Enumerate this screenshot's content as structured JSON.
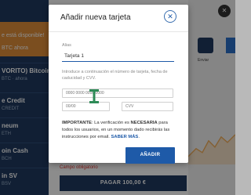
{
  "background": {
    "promo_line1": "e está disponible!",
    "promo_line2": "BTC ahora",
    "list": [
      {
        "title": "VORITO) Bitcoin",
        "sub": "BTC · ahora"
      },
      {
        "title": "e Credit",
        "sub": "CREDIT"
      },
      {
        "title": "neum",
        "sub": "ETH"
      },
      {
        "title": "oin Cash",
        "sub": "BCH"
      },
      {
        "title": "in SV",
        "sub": "BSV"
      }
    ],
    "right_label": "Enviar",
    "right_close": "✕",
    "error_text": "Campo obligatorio",
    "pay_button": "PAGAR  100,00 €"
  },
  "modal": {
    "title": "Añadir nueva tarjeta",
    "close_icon": "close-icon",
    "alias_label": "Alias",
    "alias_value": "Tarjeta 1",
    "instruction": "Introduce a continuación el número de tarjeta, fecha de caducidad y CVV.",
    "card_number_placeholder": "0000 0000 0000 0000",
    "expiry_placeholder": "00/00",
    "cvv_placeholder": "CVV",
    "notice_strong1": "IMPORTANTE",
    "notice_part1": ": La verificación es ",
    "notice_strong2": "NECESARIA",
    "notice_part2": " para todos los usuarios, en un momento dado recibirás las instrucciones por email. ",
    "saber_mas": "SABER MÁS",
    "notice_end": ".",
    "add_button": "AÑADIR"
  },
  "colors": {
    "accent": "#1e5aa8",
    "navy": "#1f3a60",
    "error": "#e53935",
    "cursor": "#2e8b57"
  }
}
